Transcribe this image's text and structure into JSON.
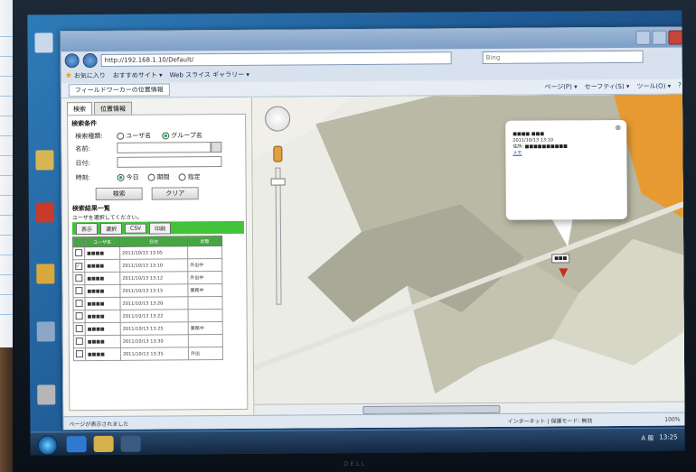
{
  "browser": {
    "address_url": "http://192.168.1.10/Default/",
    "search_placeholder": "Bing",
    "favorites": [
      "お気に入り",
      "おすすめサイト ▾",
      "Web スライス ギャラリー ▾"
    ],
    "tab_title": "フィールドワーカーの位置情報",
    "commands": [
      "ページ(P) ▾",
      "セーフティ(S) ▾",
      "ツール(O) ▾",
      "?"
    ]
  },
  "panel": {
    "tabs": [
      "検索",
      "位置情報"
    ],
    "section_title": "検索条件",
    "fields": [
      {
        "label": "検索種類:",
        "options": [
          "ユーザ名",
          "グループ名"
        ],
        "selected": 1
      },
      {
        "label": "名前:",
        "value": ""
      },
      {
        "label": "日付:",
        "value": ""
      },
      {
        "label": "時刻:",
        "options": [
          "今日",
          "期間",
          "指定"
        ],
        "selected": 0
      }
    ],
    "search_button": "検索",
    "clear_button": "クリア",
    "results_title": "検索結果一覧",
    "results_note": "ユーザを選択してください。",
    "action_buttons": [
      "表示",
      "選択",
      "CSV",
      "印刷"
    ],
    "table_headers": [
      "",
      "ユーザ名",
      "日付",
      "状態"
    ],
    "rows": [
      {
        "checked": false,
        "name": "■■■■",
        "date": "2011/10/13 13:05",
        "status": ""
      },
      {
        "checked": true,
        "name": "■■■■",
        "date": "2011/10/13 13:10",
        "status": "外出中"
      },
      {
        "checked": false,
        "name": "■■■■",
        "date": "2011/10/13 13:12",
        "status": "外出中"
      },
      {
        "checked": false,
        "name": "■■■■",
        "date": "2011/10/13 13:15",
        "status": "業務中"
      },
      {
        "checked": false,
        "name": "■■■■",
        "date": "2011/10/13 13:20",
        "status": ""
      },
      {
        "checked": false,
        "name": "■■■■",
        "date": "2011/10/13 13:22",
        "status": ""
      },
      {
        "checked": false,
        "name": "■■■■",
        "date": "2011/10/13 13:25",
        "status": "業務中"
      },
      {
        "checked": false,
        "name": "■■■■",
        "date": "2011/10/13 13:30",
        "status": ""
      },
      {
        "checked": false,
        "name": "■■■■",
        "date": "2011/10/13 13:35",
        "status": "外出"
      }
    ]
  },
  "map": {
    "popup_lines": [
      "■■■■ ■■■",
      "2011/10/13 13:10",
      "住所: ■■■■■■■■■■",
      "メモ"
    ],
    "marker_label": "■■■"
  },
  "status": {
    "left": "ページが表示されました",
    "zone": "インターネット | 保護モード: 無効",
    "zoom": "100%"
  },
  "taskbar": {
    "clock": "13:25",
    "lang": "A 般"
  },
  "colors": {
    "grid_header": "#46a640",
    "action_bar": "#43c33a",
    "map_building": "#b9b9a5",
    "map_orange": "#e79a32"
  }
}
